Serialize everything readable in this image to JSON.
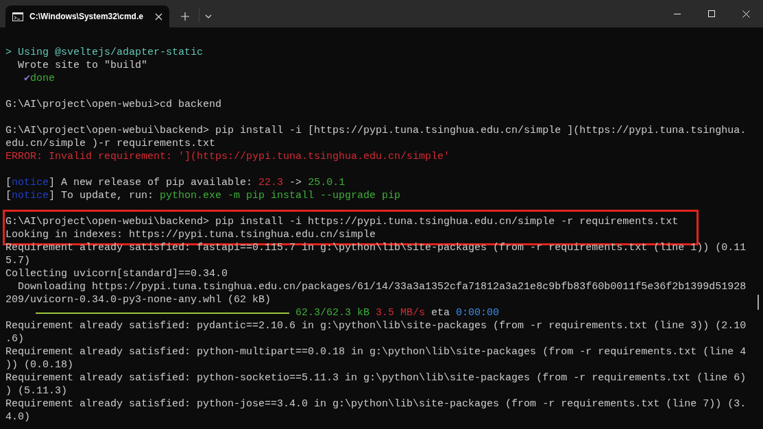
{
  "window": {
    "tab_title": "C:\\Windows\\System32\\cmd.e"
  },
  "blocks": [
    {
      "lines": [
        {
          "kind": "text",
          "segments": [
            {
              "text": "> Using @sveltejs/adapter-static",
              "color": "#61c4b4"
            }
          ]
        },
        {
          "kind": "text",
          "segments": [
            {
              "text": "  Wrote site to \"build\"",
              "color": "#cccccc"
            }
          ]
        },
        {
          "kind": "text",
          "segments": [
            {
              "text": "   ✔",
              "color": "#8f6fd6"
            },
            {
              "text": "done",
              "color": "#3fae3a"
            }
          ]
        }
      ]
    },
    {
      "lines": [
        {
          "kind": "text",
          "segments": [
            {
              "text": "G:\\AI\\project\\open-webui>cd backend",
              "color": "#cccccc"
            }
          ]
        }
      ]
    },
    {
      "lines": [
        {
          "kind": "text",
          "segments": [
            {
              "text": "G:\\AI\\project\\open-webui\\backend> pip install -i [https://pypi.tuna.tsinghua.edu.cn/simple ](https://pypi.tuna.tsinghua.",
              "color": "#cccccc"
            }
          ]
        },
        {
          "kind": "text",
          "segments": [
            {
              "text": "edu.cn/simple )-r requirements.txt",
              "color": "#cccccc"
            }
          ]
        },
        {
          "kind": "text",
          "segments": [
            {
              "text": "ERROR: Invalid requirement: '](https://pypi.tuna.tsinghua.edu.cn/simple'",
              "color": "#d42a33"
            }
          ]
        }
      ]
    },
    {
      "lines": [
        {
          "kind": "text",
          "segments": [
            {
              "text": "[",
              "color": "#cccccc"
            },
            {
              "text": "notice",
              "color": "#1f3fc8"
            },
            {
              "text": "] A new release of pip available: ",
              "color": "#cccccc"
            },
            {
              "text": "22.3",
              "color": "#d42a33"
            },
            {
              "text": " -> ",
              "color": "#cccccc"
            },
            {
              "text": "25.0.1",
              "color": "#3fae3a"
            }
          ]
        },
        {
          "kind": "text",
          "segments": [
            {
              "text": "[",
              "color": "#cccccc"
            },
            {
              "text": "notice",
              "color": "#1f3fc8"
            },
            {
              "text": "] To update, run: ",
              "color": "#cccccc"
            },
            {
              "text": "python.exe -m pip install --upgrade pip",
              "color": "#3fae3a"
            }
          ]
        }
      ]
    },
    {
      "boxed_lines": [
        {
          "kind": "text",
          "segments": [
            {
              "text": "G:\\AI\\project\\open-webui\\backend> pip install -i https://pypi.tuna.tsinghua.edu.cn/simple -r requirements.txt",
              "color": "#cccccc"
            }
          ]
        },
        {
          "kind": "text",
          "segments": [
            {
              "text": "Looking in indexes: https://pypi.tuna.tsinghua.edu.cn/simple",
              "color": "#cccccc"
            }
          ]
        }
      ],
      "lines": [
        {
          "kind": "text",
          "segments": [
            {
              "text": "Requirement already satisfied: fastapi==0.115.7 in g:\\python\\lib\\site-packages (from -r requirements.txt (line 1)) (0.11",
              "color": "#cccccc"
            }
          ]
        },
        {
          "kind": "text",
          "segments": [
            {
              "text": "5.7)",
              "color": "#cccccc"
            }
          ]
        },
        {
          "kind": "text",
          "segments": [
            {
              "text": "Collecting uvicorn[standard]==0.34.0",
              "color": "#cccccc"
            }
          ]
        },
        {
          "kind": "text",
          "segments": [
            {
              "text": "  Downloading https://pypi.tuna.tsinghua.edu.cn/packages/61/14/33a3a1352cfa71812a3a21e8c9bfb83f60b0011f5e36f2b1399d51928",
              "color": "#cccccc"
            }
          ]
        },
        {
          "kind": "text",
          "segments": [
            {
              "text": "209/uvicorn-0.34.0-py3-none-any.whl (62 kB)",
              "color": "#cccccc"
            }
          ]
        },
        {
          "kind": "progress",
          "level": 1,
          "segments": [
            {
              "text": "62.3/62.3 kB",
              "color": "#3fae3a"
            },
            {
              "text": " 3.5 MB/s",
              "color": "#d42a33"
            },
            {
              "text": " eta ",
              "color": "#cccccc"
            },
            {
              "text": "0:00:00",
              "color": "#3b8eea"
            }
          ]
        },
        {
          "kind": "text",
          "segments": [
            {
              "text": "Requirement already satisfied: pydantic==2.10.6 in g:\\python\\lib\\site-packages (from -r requirements.txt (line 3)) (2.10",
              "color": "#cccccc"
            }
          ]
        },
        {
          "kind": "text",
          "segments": [
            {
              "text": ".6)",
              "color": "#cccccc"
            }
          ]
        },
        {
          "kind": "text",
          "segments": [
            {
              "text": "Requirement already satisfied: python-multipart==0.0.18 in g:\\python\\lib\\site-packages (from -r requirements.txt (line 4",
              "color": "#cccccc"
            }
          ]
        },
        {
          "kind": "text",
          "segments": [
            {
              "text": ")) (0.0.18)",
              "color": "#cccccc"
            }
          ]
        },
        {
          "kind": "text",
          "segments": [
            {
              "text": "Requirement already satisfied: python-socketio==5.11.3 in g:\\python\\lib\\site-packages (from -r requirements.txt (line 6)",
              "color": "#cccccc"
            }
          ]
        },
        {
          "kind": "text",
          "segments": [
            {
              "text": ") (5.11.3)",
              "color": "#cccccc"
            }
          ]
        },
        {
          "kind": "text",
          "segments": [
            {
              "text": "Requirement already satisfied: python-jose==3.4.0 in g:\\python\\lib\\site-packages (from -r requirements.txt (line 7)) (3.",
              "color": "#cccccc"
            }
          ]
        },
        {
          "kind": "text",
          "segments": [
            {
              "text": "4.0)",
              "color": "#cccccc"
            }
          ]
        }
      ]
    }
  ]
}
